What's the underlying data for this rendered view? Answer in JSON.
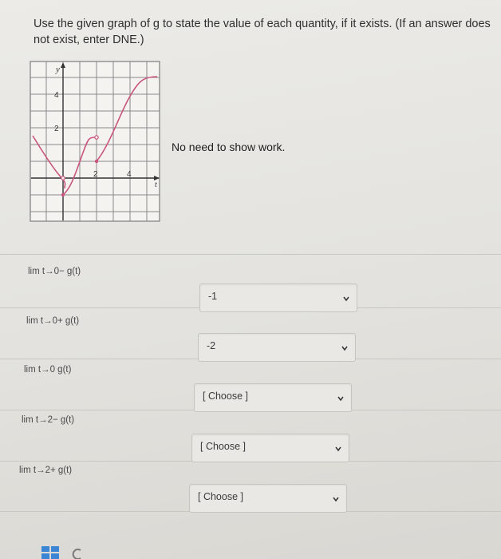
{
  "instructions": "Use the given graph of g to state the value of each quantity, if it exists. (If an answer does not exist, enter DNE.)",
  "note": "No need to show work.",
  "graph": {
    "y_axis_label": "y",
    "x_axis_label": "t",
    "y_ticks": [
      "4",
      "2"
    ],
    "x_ticks": [
      "2",
      "4"
    ]
  },
  "questions": [
    {
      "label": "lim t→0− g(t)",
      "selected": "-1"
    },
    {
      "label": "lim t→0+ g(t)",
      "selected": "-2"
    },
    {
      "label": "lim t→0 g(t)",
      "selected": "[ Choose ]"
    },
    {
      "label": "lim t→2− g(t)",
      "selected": "[ Choose ]"
    },
    {
      "label": "lim t→2+ g(t)",
      "selected": "[ Choose ]"
    }
  ],
  "colors": {
    "curve": "#c9557f",
    "grid": "#8a8a8a"
  },
  "icons": [
    "chevron-down-icon",
    "windows-icon",
    "app-icon"
  ]
}
